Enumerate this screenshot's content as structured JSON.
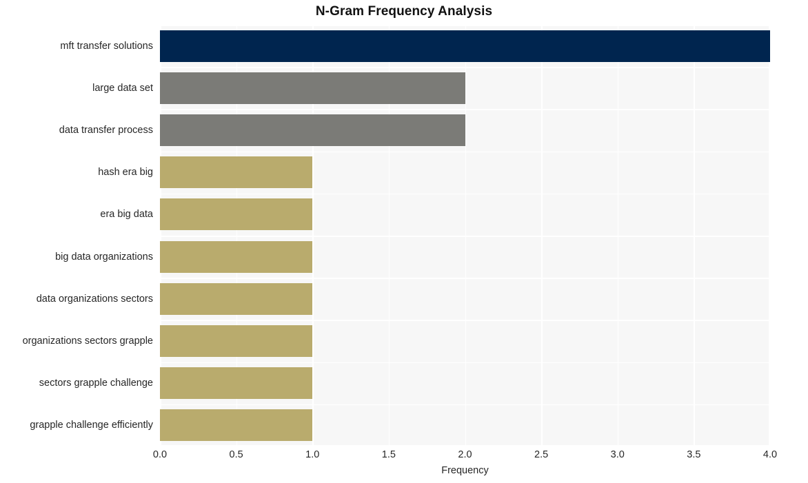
{
  "chart_data": {
    "type": "bar",
    "orientation": "horizontal",
    "title": "N-Gram Frequency Analysis",
    "xlabel": "Frequency",
    "ylabel": "",
    "xlim": [
      0,
      4
    ],
    "xticks": [
      "0.0",
      "0.5",
      "1.0",
      "1.5",
      "2.0",
      "2.5",
      "3.0",
      "3.5",
      "4.0"
    ],
    "xtick_values": [
      0,
      0.5,
      1,
      1.5,
      2,
      2.5,
      3,
      3.5,
      4
    ],
    "grid": true,
    "legend": "none",
    "categories": [
      "mft transfer solutions",
      "large data set",
      "data transfer process",
      "hash era big",
      "era big data",
      "big data organizations",
      "data organizations sectors",
      "organizations sectors grapple",
      "sectors grapple challenge",
      "grapple challenge efficiently"
    ],
    "values": [
      4,
      2,
      2,
      1,
      1,
      1,
      1,
      1,
      1,
      1
    ],
    "bar_colors": [
      "#00254f",
      "#7b7b77",
      "#7b7b77",
      "#b9ab6d",
      "#b9ab6d",
      "#b9ab6d",
      "#b9ab6d",
      "#b9ab6d",
      "#b9ab6d",
      "#b9ab6d"
    ],
    "plot_background": "#f7f7f7",
    "grid_color": "#ffffff",
    "text_color": "#262626"
  }
}
